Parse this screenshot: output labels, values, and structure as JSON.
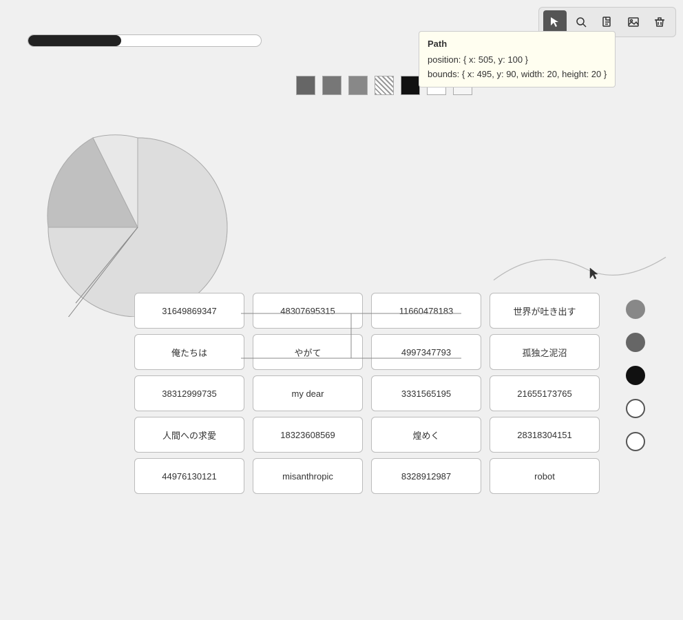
{
  "toolbar": {
    "buttons": [
      {
        "name": "cursor-tool",
        "label": "▶",
        "active": true,
        "icon": "cursor"
      },
      {
        "name": "search-tool",
        "label": "🔍",
        "active": false,
        "icon": "search"
      },
      {
        "name": "export-pdf-tool",
        "label": "PDF",
        "active": false,
        "icon": "pdf"
      },
      {
        "name": "image-tool",
        "label": "IMG",
        "active": false,
        "icon": "image"
      },
      {
        "name": "delete-tool",
        "label": "🗑",
        "active": false,
        "icon": "trash"
      }
    ]
  },
  "progress": {
    "value": 40,
    "max": 100
  },
  "tooltip": {
    "title": "Path",
    "position_label": "position:",
    "position_value": "{ x: 505, y: 100 }",
    "bounds_label": "bounds:",
    "bounds_value": "{ x: 495, y: 90, width: 20, height: 20 }"
  },
  "swatches": [
    {
      "color": "#666",
      "type": "solid",
      "label": "dark-gray"
    },
    {
      "color": "#777",
      "type": "solid",
      "label": "medium-gray"
    },
    {
      "color": "#888",
      "type": "solid",
      "label": "gray"
    },
    {
      "color": "hatched",
      "type": "hatched",
      "label": "hatched"
    },
    {
      "color": "#111",
      "type": "solid",
      "label": "black"
    },
    {
      "color": "#fff",
      "type": "solid",
      "label": "white"
    },
    {
      "color": "#f5f5f5",
      "type": "solid",
      "label": "light-white"
    }
  ],
  "grid": {
    "rows": [
      [
        "31649869347",
        "48307695315",
        "11660478183",
        "世界が吐き出す"
      ],
      [
        "俺たちは",
        "やがて",
        "4997347793",
        "孤独之泥沼"
      ],
      [
        "38312999735",
        "my dear",
        "3331565195",
        "21655173765"
      ],
      [
        "人間への求愛",
        "18323608569",
        "煌めく",
        "28318304151"
      ],
      [
        "44976130121",
        "misanthropic",
        "8328912987",
        "robot"
      ]
    ]
  },
  "circles": [
    {
      "style": "dark1"
    },
    {
      "style": "dark2"
    },
    {
      "style": "black"
    },
    {
      "style": "white1"
    },
    {
      "style": "white2"
    }
  ]
}
